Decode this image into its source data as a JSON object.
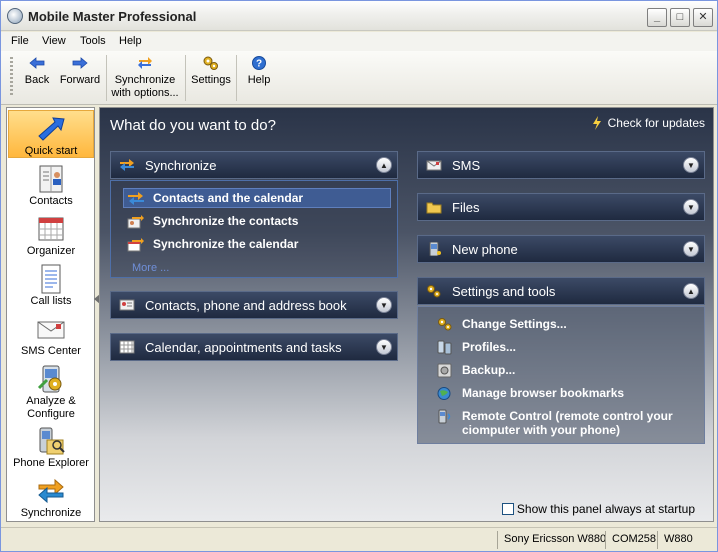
{
  "window": {
    "title": "Mobile Master Professional",
    "controls": {
      "minimize": "_",
      "maximize": "□",
      "close": "✕"
    }
  },
  "menubar": [
    {
      "label": "File"
    },
    {
      "label": "View"
    },
    {
      "label": "Tools"
    },
    {
      "label": "Help"
    }
  ],
  "toolbar": {
    "back": "Back",
    "forward": "Forward",
    "sync_line1": "Synchronize",
    "sync_line2": "with options...",
    "settings": "Settings",
    "help": "Help"
  },
  "sidebar": [
    {
      "label": "Quick start",
      "icon": "quick-start-icon",
      "active": true
    },
    {
      "label": "Contacts",
      "icon": "contacts-icon"
    },
    {
      "label": "Organizer",
      "icon": "organizer-icon"
    },
    {
      "label": "Call lists",
      "icon": "call-lists-icon"
    },
    {
      "label": "SMS Center",
      "icon": "sms-center-icon"
    },
    {
      "label_line1": "Analyze &",
      "label_line2": "Configure",
      "icon": "analyze-configure-icon"
    },
    {
      "label": "Phone Explorer",
      "icon": "phone-explorer-icon"
    },
    {
      "label": "Synchronize",
      "icon": "synchronize-icon"
    }
  ],
  "main": {
    "title": "What do you want to do?",
    "check_updates": "Check for updates",
    "left_panels": {
      "synchronize": {
        "label": "Synchronize",
        "items": [
          {
            "label": "Contacts and the calendar"
          },
          {
            "label": "Synchronize the contacts"
          },
          {
            "label": "Synchronize the calendar"
          }
        ],
        "more": "More ..."
      },
      "contacts_phone": {
        "label": "Contacts, phone and address book"
      },
      "calendar": {
        "label": "Calendar, appointments and tasks"
      }
    },
    "right_panels": {
      "sms": {
        "label": "SMS"
      },
      "files": {
        "label": "Files"
      },
      "new_phone": {
        "label": "New phone"
      },
      "settings_tools": {
        "label": "Settings and tools",
        "items": [
          {
            "label": "Change Settings..."
          },
          {
            "label": "Profiles..."
          },
          {
            "label": "Backup..."
          },
          {
            "label": "Manage browser bookmarks"
          },
          {
            "label_line1": "Remote Control  (remote control your",
            "label_line2": "ciomputer with your phone)"
          }
        ]
      }
    },
    "startup_checkbox": "Show this panel always at startup"
  },
  "statusbar": {
    "phone": "Sony Ericsson W880",
    "port": "COM258",
    "model": "W880"
  },
  "colors": {
    "title_text": "#222222",
    "main_panel_dark": "#1f2a40",
    "highlight": "#3f5c93",
    "more_link": "#6f8fd8",
    "active_sidebar": "#ffb73d"
  }
}
